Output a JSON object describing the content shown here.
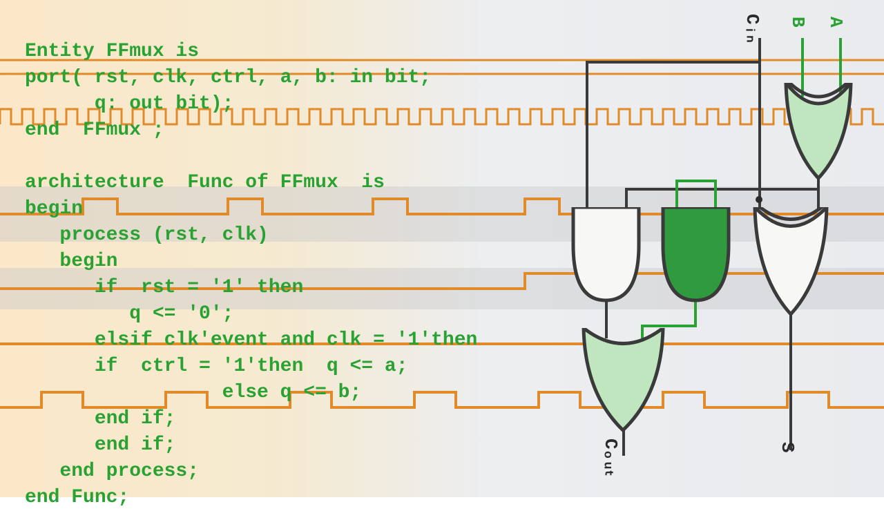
{
  "code": {
    "l0": "Entity FFmux is",
    "l1": "port( rst, clk, ctrl, a, b: in bit;",
    "l2": "      q: out bit);",
    "l3": "end  FFmux ;",
    "l4": "",
    "l5": "architecture  Func of FFmux  is",
    "l6": "begin",
    "l7": "   process (rst, clk)",
    "l8": "   begin",
    "l9": "      if  rst = '1' then",
    "l10": "         q <= '0';",
    "l11": "      elsif clk'event and clk = '1'then",
    "l12": "      if  ctrl = '1'then  q <= a;",
    "l13": "                 else q <= b;",
    "l14": "      end if;",
    "l15": "      end if;",
    "l16": "   end process;",
    "l17": "end Func;"
  },
  "labels": {
    "cin": "Cᵢₙ",
    "b": "B",
    "a": "A",
    "cout": "Cₒᵤₜ",
    "s": "S"
  },
  "colors": {
    "code": "#2aa233",
    "wave": "#e08a2a",
    "gate_light": "#bfe6bf",
    "gate_dark": "#2f9b3e",
    "stroke": "#3a3a3a"
  }
}
